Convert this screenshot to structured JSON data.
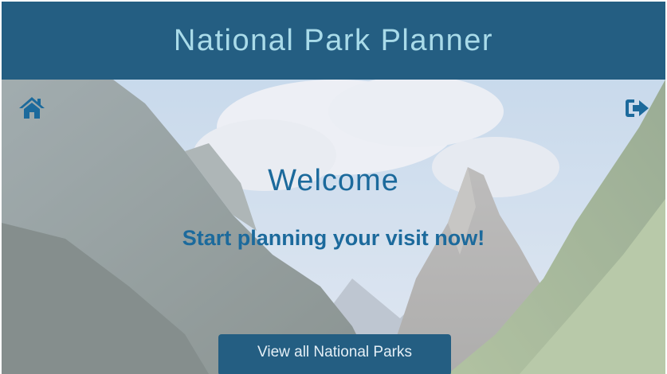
{
  "header": {
    "title": "National Park Planner",
    "background_color": "#245e82",
    "title_color": "#a9dbe9"
  },
  "nav": {
    "home_icon": "home-icon",
    "logout_icon": "sign-out-icon",
    "icon_color": "#1c6a9c"
  },
  "hero": {
    "background": "mountain-valley-photo",
    "welcome": "Welcome",
    "tagline": "Start planning your visit now!",
    "text_color": "#1c6a9c"
  },
  "actions": {
    "view_parks_label": "View all National Parks",
    "button_color": "#245e82"
  }
}
